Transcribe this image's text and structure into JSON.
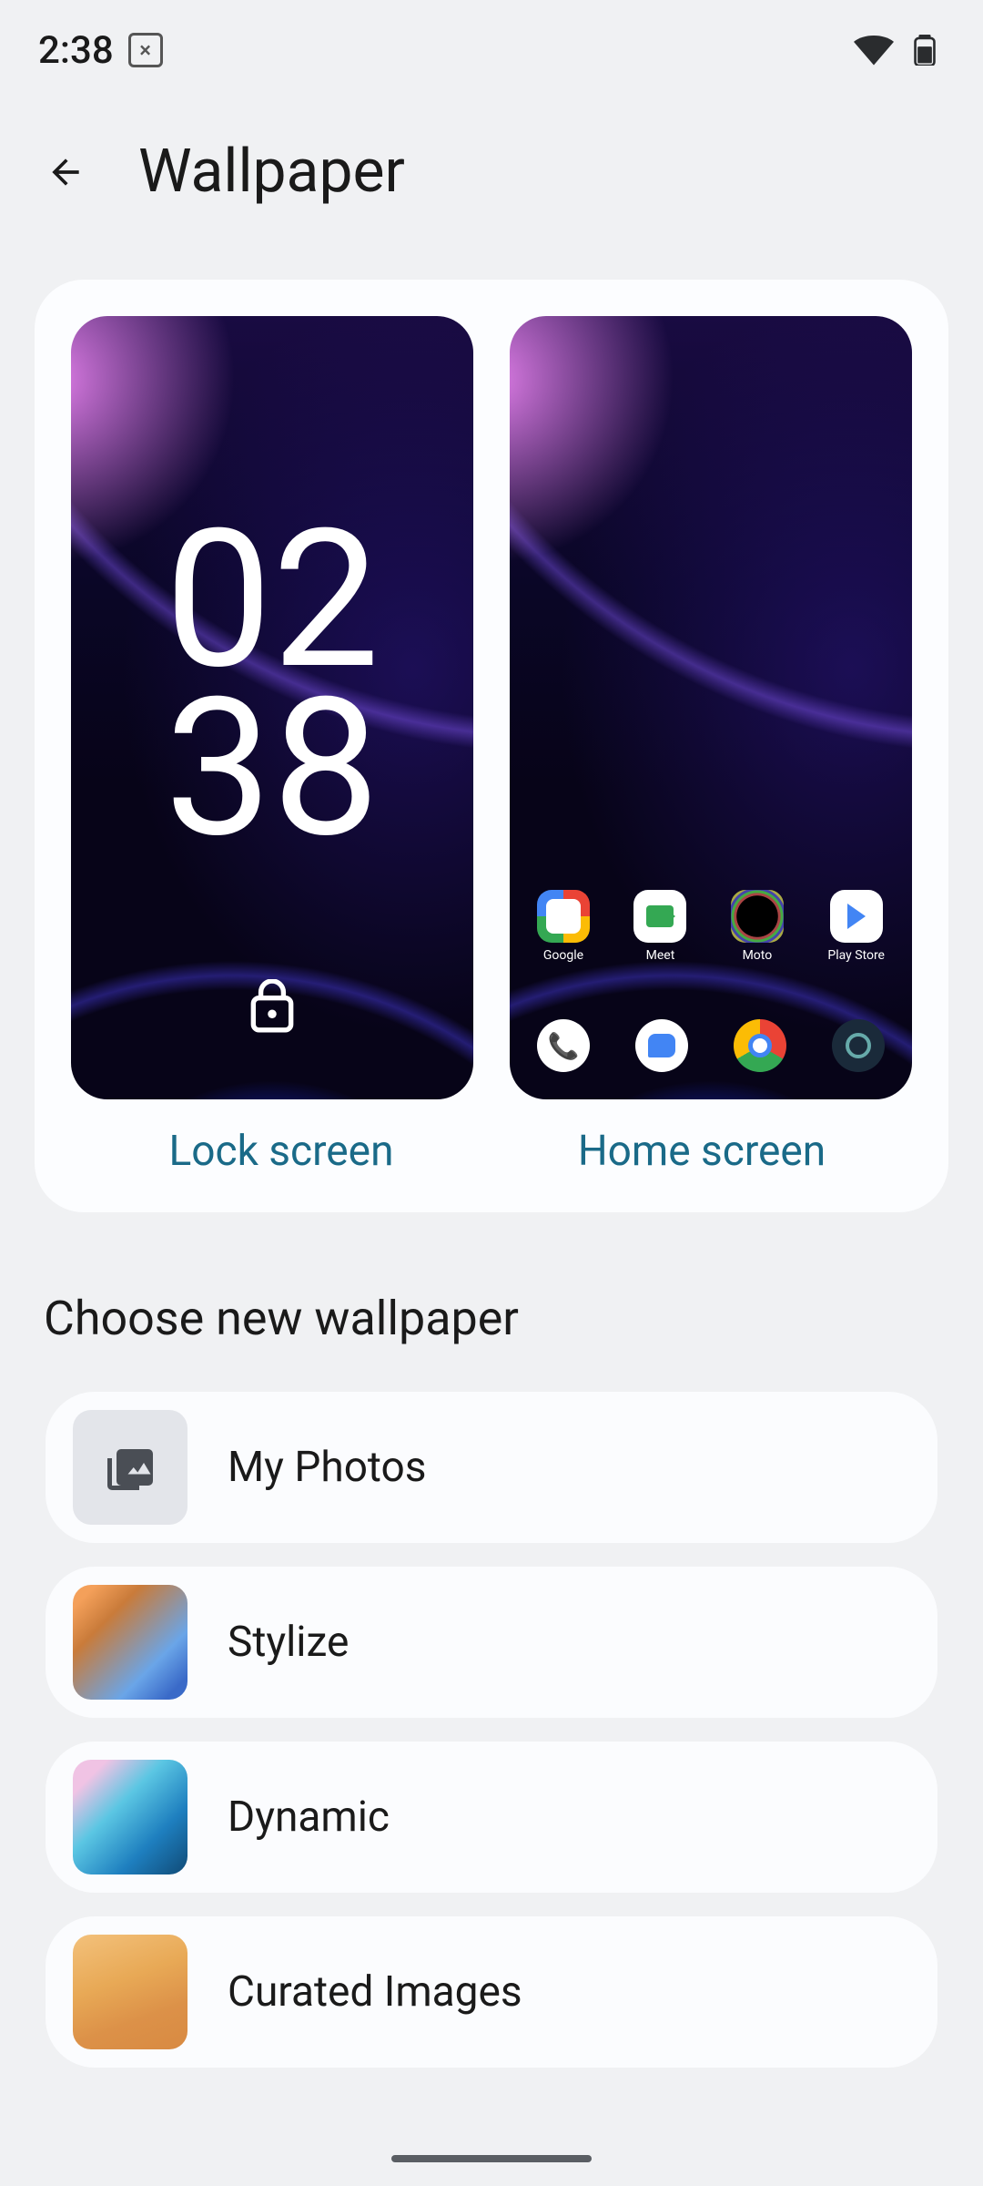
{
  "status": {
    "time": "2:38"
  },
  "header": {
    "title": "Wallpaper"
  },
  "previews": {
    "lock": {
      "time_hour": "02",
      "time_min": "38",
      "label": "Lock screen"
    },
    "home": {
      "label": "Home screen",
      "apps_row1": [
        "Google",
        "Meet",
        "Moto",
        "Play Store"
      ]
    }
  },
  "section_heading": "Choose new wallpaper",
  "categories": [
    {
      "key": "my_photos",
      "label": "My Photos"
    },
    {
      "key": "stylize",
      "label": "Stylize"
    },
    {
      "key": "dynamic",
      "label": "Dynamic"
    },
    {
      "key": "curated",
      "label": "Curated Images"
    }
  ]
}
